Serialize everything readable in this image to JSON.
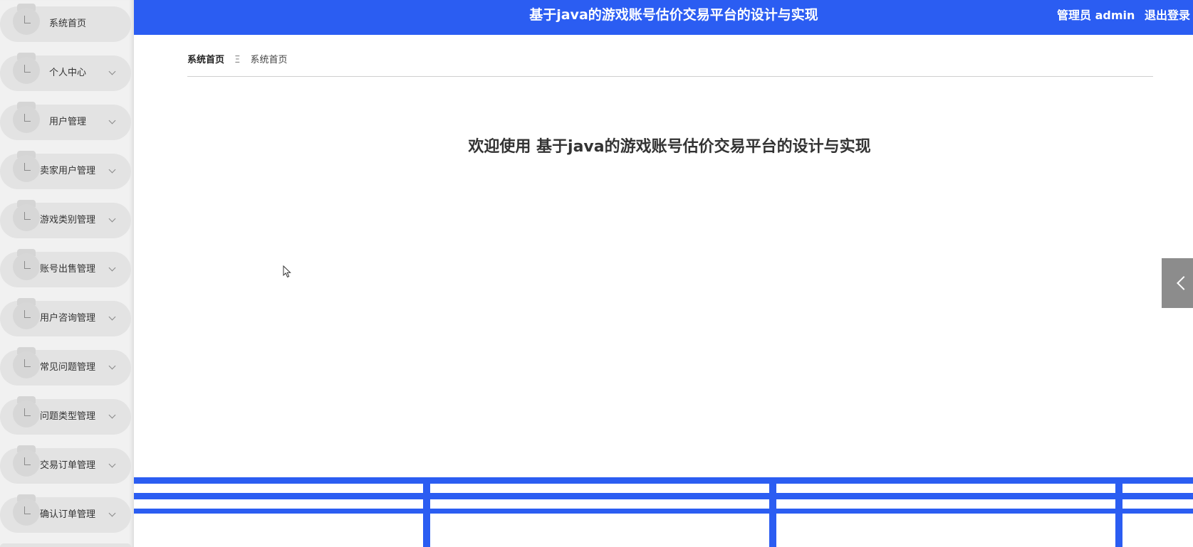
{
  "header": {
    "title": "基于java的游戏账号估价交易平台的设计与实现",
    "user_label": "管理员 admin",
    "logout_label": "退出登录"
  },
  "breadcrumb": {
    "home": "系统首页",
    "separator": "Ξ",
    "current": "系统首页"
  },
  "welcome": {
    "text": "欢迎使用 基于java的游戏账号估价交易平台的设计与实现"
  },
  "sidebar": {
    "items": [
      {
        "label": "系统首页",
        "has_submenu": false
      },
      {
        "label": "个人中心",
        "has_submenu": true
      },
      {
        "label": "用户管理",
        "has_submenu": true
      },
      {
        "label": "卖家用户管理",
        "has_submenu": true
      },
      {
        "label": "游戏类别管理",
        "has_submenu": true
      },
      {
        "label": "账号出售管理",
        "has_submenu": true
      },
      {
        "label": "用户咨询管理",
        "has_submenu": true
      },
      {
        "label": "常见问题管理",
        "has_submenu": true
      },
      {
        "label": "问题类型管理",
        "has_submenu": true
      },
      {
        "label": "交易订单管理",
        "has_submenu": true
      },
      {
        "label": "确认订单管理",
        "has_submenu": true
      }
    ]
  },
  "colors": {
    "accent": "#2b5df2",
    "sidebar_bg": "#f1f1f1",
    "item_bg": "#e3e3e3",
    "toggle_bg": "#8c8c8c"
  },
  "icons": {
    "sidebar_item": "menu-item-icon",
    "submenu": "chevron-down-icon",
    "toggle": "chevron-left-icon"
  }
}
